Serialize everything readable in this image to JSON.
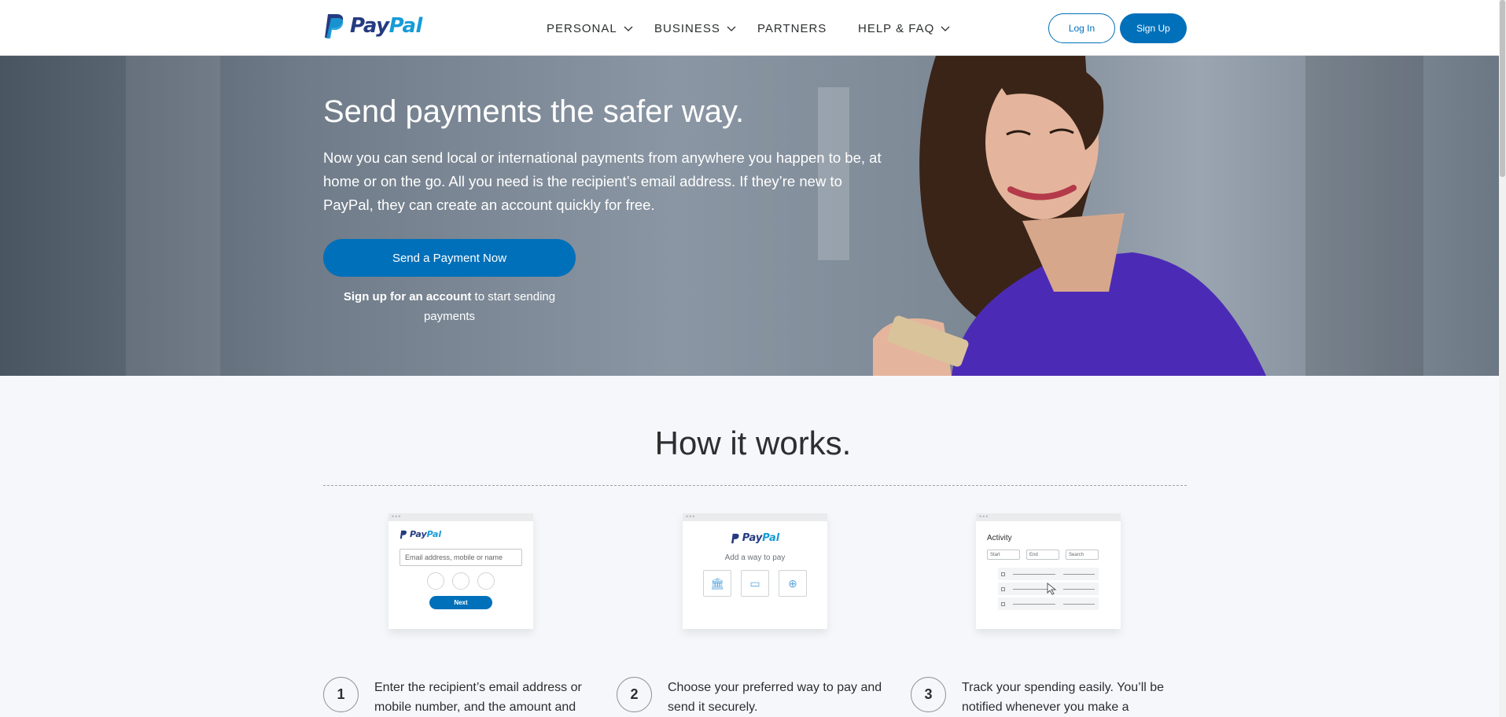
{
  "header": {
    "logo_text_pay": "Pay",
    "logo_text_pal": "Pal",
    "nav": [
      {
        "label": "PERSONAL",
        "has_dropdown": true
      },
      {
        "label": "BUSINESS",
        "has_dropdown": true
      },
      {
        "label": "PARTNERS",
        "has_dropdown": false
      },
      {
        "label": "HELP & FAQ",
        "has_dropdown": true
      }
    ],
    "login_label": "Log In",
    "signup_label": "Sign Up"
  },
  "hero": {
    "title": "Send payments the safer way.",
    "description": "Now you can send local or international payments from anywhere you happen to be, at home or on the go. All you need is the recipient’s email address. If they’re new to PayPal, they can create an account quickly for free.",
    "cta_label": "Send a Payment Now",
    "signup_link": "Sign up for an account",
    "signup_rest": " to start sending payments"
  },
  "how_it_works": {
    "title": "How it works.",
    "card1": {
      "input_placeholder": "Email address, mobile or name",
      "next_label": "Next"
    },
    "card2": {
      "subtitle": "Add a way to pay"
    },
    "card3": {
      "title": "Activity",
      "filter_start": "Start",
      "filter_end": "End",
      "filter_search": "Search"
    },
    "steps": [
      {
        "number": "1",
        "text": "Enter the recipient’s email address or mobile number, and the amount and"
      },
      {
        "number": "2",
        "text": "Choose your preferred way to pay and send it securely."
      },
      {
        "number": "3",
        "text": "Track your spending easily. You’ll be notified whenever you make a"
      }
    ]
  },
  "colors": {
    "brand_blue": "#0070ba",
    "logo_dark": "#253b80",
    "logo_light": "#179bd7",
    "dress_purple": "#4b2bb5"
  }
}
